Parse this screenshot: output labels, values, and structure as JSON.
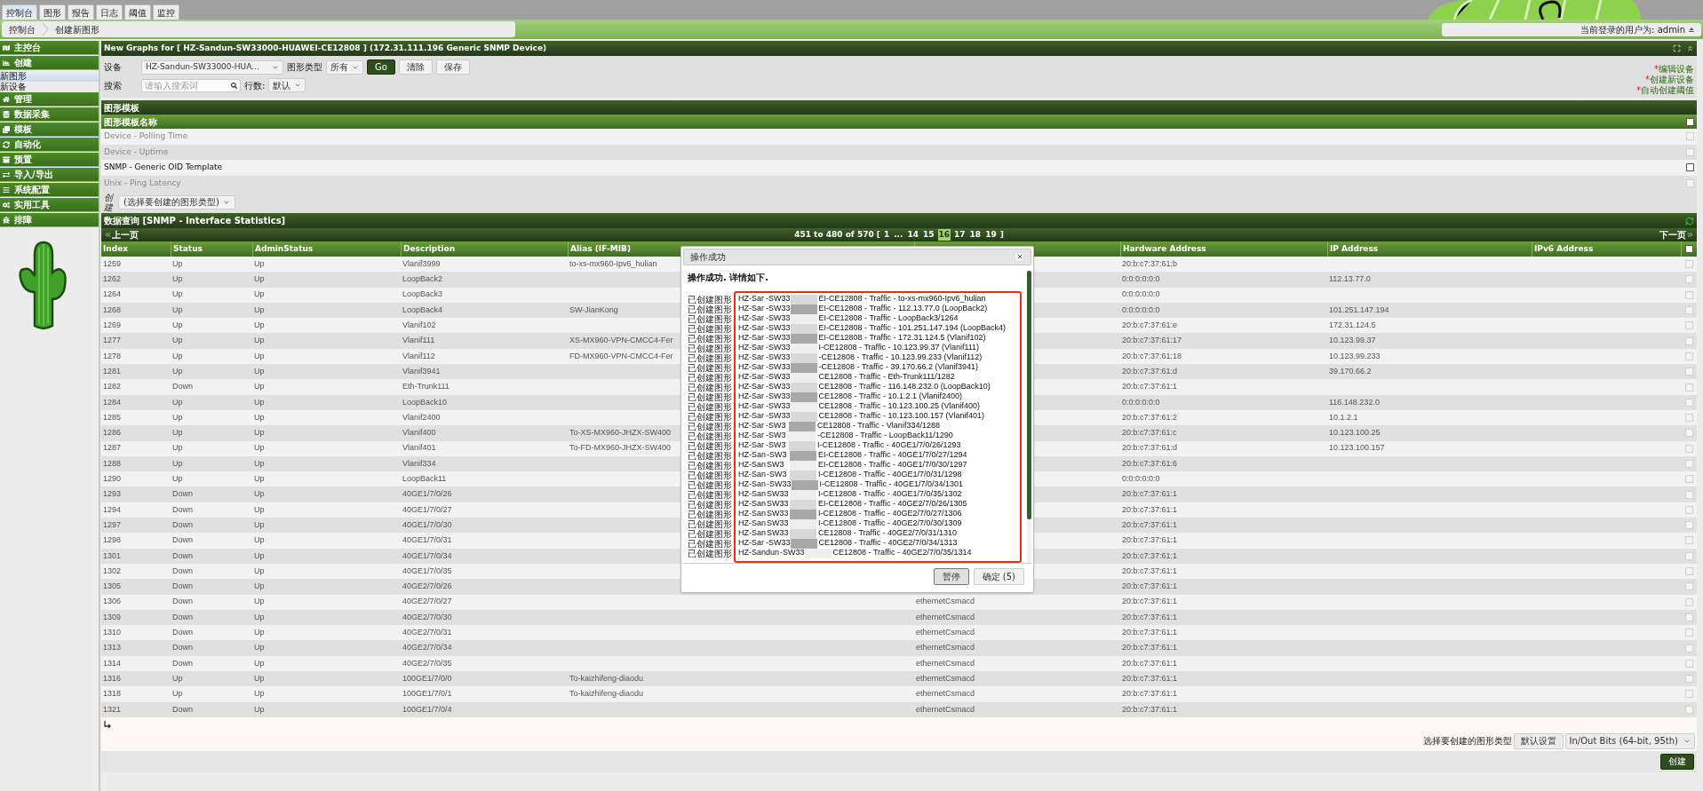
{
  "top_tabs": [
    {
      "label": "控制台",
      "selected": true
    },
    {
      "label": "图形",
      "selected": false
    },
    {
      "label": "报告",
      "selected": false
    },
    {
      "label": "日志",
      "selected": false
    },
    {
      "label": "阈值",
      "selected": false
    },
    {
      "label": "监控",
      "selected": false
    }
  ],
  "breadcrumb": [
    "控制台",
    "创建新图形"
  ],
  "user": {
    "label": "当前登录的用户为: admin"
  },
  "sidebar": [
    {
      "kind": "section",
      "label": "主控台"
    },
    {
      "kind": "section",
      "label": "创建"
    },
    {
      "kind": "link",
      "label": "新图形",
      "selected": true
    },
    {
      "kind": "link",
      "label": "新设备",
      "selected": false
    },
    {
      "kind": "section",
      "label": "管理"
    },
    {
      "kind": "section",
      "label": "数据采集"
    },
    {
      "kind": "section",
      "label": "模板"
    },
    {
      "kind": "section",
      "label": "自动化"
    },
    {
      "kind": "section",
      "label": "预置"
    },
    {
      "kind": "section",
      "label": "导入/导出"
    },
    {
      "kind": "section",
      "label": "系统配置"
    },
    {
      "kind": "section",
      "label": "实用工具"
    },
    {
      "kind": "section",
      "label": "排障"
    }
  ],
  "panel_title": "New Graphs for [ HZ-Sandun-SW33000-HUAWEI-CE12808 ] (172.31.111.196 Generic SNMP Device)",
  "form": {
    "device_label": "设备",
    "device_value": "HZ-Sandun-SW33000-HUA...",
    "type_label": "图形类型",
    "type_value": "所有",
    "buttons": [
      "Go",
      "清除",
      "保存"
    ],
    "search_label": "搜索",
    "search_placeholder": "请输入搜索词",
    "rows_label": "行数:",
    "rows_value": "默认",
    "links": [
      {
        "marker": "*",
        "label": "编辑设备"
      },
      {
        "marker": "*",
        "label": "创建新设备"
      },
      {
        "marker": "*",
        "label": "自动创建阈值"
      }
    ]
  },
  "templates": {
    "title": "图形模板",
    "column": "图形模板名称",
    "select_all_checked": false,
    "rows": [
      {
        "name": "Device - Polling Time",
        "disabled": true,
        "checked": false
      },
      {
        "name": "Device - Uptime",
        "disabled": true,
        "checked": false
      },
      {
        "name": "SNMP - Generic OID Template",
        "disabled": false,
        "checked": false
      },
      {
        "name": "Unix - Ping Latency",
        "disabled": true,
        "checked": false
      }
    ],
    "create_label": "创建",
    "create_select": "(选择要创建的图形类型)"
  },
  "query": {
    "title": "数据查询 [SNMP - Interface Statistics]",
    "prev": "上一页",
    "next": "下一页",
    "range": "451 to 480 of 570 [",
    "pages": [
      {
        "label": "1",
        "selected": false
      },
      {
        "label": "...",
        "selected": false
      },
      {
        "label": "14",
        "selected": false
      },
      {
        "label": "15",
        "selected": false
      },
      {
        "label": "16",
        "selected": true
      },
      {
        "label": "17",
        "selected": false
      },
      {
        "label": "18",
        "selected": false
      },
      {
        "label": "19",
        "selected": false
      }
    ],
    "range_end": "]",
    "columns": [
      "Index",
      "Status",
      "AdminStatus",
      "Description",
      "Alias (IF-MIB)",
      "Hardware Address",
      "IP Address",
      "IPv6 Address"
    ],
    "select_all_checked": false,
    "rows": [
      {
        "index": "1259",
        "status": "Up",
        "admin_status": "Up",
        "description": "Vlanif3999",
        "alias": "to-xs-mx960-Ipv6_hulian",
        "hardware_address": "20:b:c7:37:61:b",
        "checked": false
      },
      {
        "index": "1262",
        "status": "Up",
        "admin_status": "Up",
        "description": "LoopBack2",
        "hardware_address": "0:0:0:0:0:0",
        "ip_address": "112.13.77.0",
        "checked": false
      },
      {
        "index": "1264",
        "status": "Up",
        "admin_status": "Up",
        "description": "LoopBack3",
        "hardware_address": "0:0:0:0:0:0",
        "checked": false
      },
      {
        "index": "1268",
        "status": "Up",
        "admin_status": "Up",
        "description": "LoopBack4",
        "alias": "SW-JianKong",
        "hardware_address": "0:0:0:0:0:0",
        "ip_address": "101.251.147.194",
        "checked": false
      },
      {
        "index": "1269",
        "status": "Up",
        "admin_status": "Up",
        "description": "Vlanif102",
        "hardware_address": "20:b:c7:37:61:e",
        "ip_address": "172.31.124.5",
        "checked": false
      },
      {
        "index": "1277",
        "status": "Up",
        "admin_status": "Up",
        "description": "Vlanif111",
        "alias": "XS-MX960-VPN-CMCC4-Fer",
        "hardware_address": "20:b:c7:37:61:17",
        "ip_address": "10.123.99.37",
        "checked": false
      },
      {
        "index": "1278",
        "status": "Up",
        "admin_status": "Up",
        "description": "Vlanif112",
        "alias": "FD-MX960-VPN-CMCC4-Fer",
        "hardware_address": "20:b:c7:37:61:18",
        "ip_address": "10.123.99.233",
        "checked": false
      },
      {
        "index": "1281",
        "status": "Up",
        "admin_status": "Up",
        "description": "Vlanif3941",
        "hardware_address": "20:b:c7:37:61:d",
        "ip_address": "39.170.66.2",
        "checked": false
      },
      {
        "index": "1282",
        "status": "Down",
        "admin_status": "Up",
        "description": "Eth-Trunk111",
        "hardware_address": "20:b:c7:37:61:1",
        "checked": false
      },
      {
        "index": "1284",
        "status": "Up",
        "admin_status": "Up",
        "description": "LoopBack10",
        "hardware_address": "0:0:0:0:0:0",
        "ip_address": "116.148.232.0",
        "checked": false
      },
      {
        "index": "1285",
        "status": "Up",
        "admin_status": "Up",
        "description": "Vlanif2400",
        "hardware_address": "20:b:c7:37:61:2",
        "ip_address": "10.1.2.1",
        "checked": false
      },
      {
        "index": "1286",
        "status": "Up",
        "admin_status": "Up",
        "description": "Vlanif400",
        "alias": "To-XS-MX960-JHZX-SW400",
        "hardware_address": "20:b:c7:37:61:c",
        "ip_address": "10.123.100.25",
        "checked": false
      },
      {
        "index": "1287",
        "status": "Up",
        "admin_status": "Up",
        "description": "Vlanif401",
        "alias": "To-FD-MX960-JHZX-SW400",
        "hardware_address": "20:b:c7:37:61:d",
        "ip_address": "10.123.100.157",
        "checked": false
      },
      {
        "index": "1288",
        "status": "Up",
        "admin_status": "Up",
        "description": "Vlanif334",
        "hardware_address": "20:b:c7:37:61:6",
        "checked": false
      },
      {
        "index": "1290",
        "status": "Up",
        "admin_status": "Up",
        "description": "LoopBack11",
        "hardware_address": "0:0:0:0:0:0",
        "checked": false
      },
      {
        "index": "1293",
        "status": "Down",
        "admin_status": "Up",
        "description": "40GE1/7/0/26",
        "hardware_address": "20:b:c7:37:61:1",
        "checked": false
      },
      {
        "index": "1294",
        "status": "Down",
        "admin_status": "Up",
        "description": "40GE1/7/0/27",
        "hardware_address": "20:b:c7:37:61:1",
        "checked": false
      },
      {
        "index": "1297",
        "status": "Down",
        "admin_status": "Up",
        "description": "40GE1/7/0/30",
        "hardware_address": "20:b:c7:37:61:1",
        "checked": false
      },
      {
        "index": "1298",
        "status": "Down",
        "admin_status": "Up",
        "description": "40GE1/7/0/31",
        "hardware_address": "20:b:c7:37:61:1",
        "checked": false
      },
      {
        "index": "1301",
        "status": "Down",
        "admin_status": "Up",
        "description": "40GE1/7/0/34",
        "hardware_address": "20:b:c7:37:61:1",
        "checked": false
      },
      {
        "index": "1302",
        "status": "Down",
        "admin_status": "Up",
        "description": "40GE1/7/0/35",
        "hardware_address": "20:b:c7:37:61:1",
        "checked": false
      },
      {
        "index": "1305",
        "status": "Down",
        "admin_status": "Up",
        "description": "40GE2/7/0/26",
        "hardware_address": "20:b:c7:37:61:1",
        "checked": false
      },
      {
        "index": "1306",
        "status": "Down",
        "admin_status": "Up",
        "description": "40GE2/7/0/27",
        "column_6": "ethernetCsmacd",
        "hardware_address": "20:b:c7:37:61:1",
        "checked": false
      },
      {
        "index": "1309",
        "status": "Down",
        "admin_status": "Up",
        "description": "40GE2/7/0/30",
        "column_6": "ethernetCsmacd",
        "hardware_address": "20:b:c7:37:61:1",
        "checked": false
      },
      {
        "index": "1310",
        "status": "Down",
        "admin_status": "Up",
        "description": "40GE2/7/0/31",
        "column_6": "ethernetCsmacd",
        "hardware_address": "20:b:c7:37:61:1",
        "checked": false
      },
      {
        "index": "1313",
        "status": "Down",
        "admin_status": "Up",
        "description": "40GE2/7/0/34",
        "column_6": "ethernetCsmacd",
        "hardware_address": "20:b:c7:37:61:1",
        "checked": false
      },
      {
        "index": "1314",
        "status": "Down",
        "admin_status": "Up",
        "description": "40GE2/7/0/35",
        "column_6": "ethernetCsmacd",
        "hardware_address": "20:b:c7:37:61:1",
        "checked": false
      },
      {
        "index": "1316",
        "status": "Up",
        "admin_status": "Up",
        "description": "100GE1/7/0/0",
        "alias": "To-kaizhifeng-diaodu",
        "column_6": "ethernetCsmacd",
        "hardware_address": "20:b:c7:37:61:1",
        "checked": false
      },
      {
        "index": "1318",
        "status": "Up",
        "admin_status": "Up",
        "description": "100GE1/7/0/1",
        "alias": "To-kaizhifeng-diaodu",
        "column_6": "ethernetCsmacd",
        "hardware_address": "20:b:c7:37:61:1",
        "checked": false
      },
      {
        "index": "1321",
        "status": "Down",
        "admin_status": "Up",
        "description": "100GE1/7/0/4",
        "column_6": "ethernetCsmacd",
        "hardware_address": "20:b:c7:37:61:1",
        "checked": false
      }
    ]
  },
  "footer": {
    "label": "选择要创建的图形类型",
    "default_button": "默认设置",
    "type_select": "In/Out Bits (64-bit, 95th)",
    "create_button": "创建"
  },
  "dialog": {
    "title": "操作成功",
    "message": "操作成功. 详情如下.",
    "buttons": [
      {
        "label": "暂停",
        "focused": true
      },
      {
        "label": "确定 (5)",
        "focused": false
      }
    ],
    "lines": [
      {
        "prefix": "已创建图形",
        "head": "HZ-Sar",
        "middle": "-SW33",
        "tail": "EI-CE12808 - Traffic - to-xs-mx960-Ipv6_hulian"
      },
      {
        "prefix": "已创建图形",
        "head": "HZ-Sar",
        "middle": "-SW33",
        "tail": "EI-CE12808 - Traffic - 112.13.77.0 (LoopBack2)"
      },
      {
        "prefix": "已创建图形",
        "head": "HZ-Sar",
        "middle": "-SW33",
        "tail": "EI-CE12808 - Traffic - LoopBack3/1264"
      },
      {
        "prefix": "已创建图形",
        "head": "HZ-Sar",
        "middle": "-SW33",
        "tail": "EI-CE12808 - Traffic - 101.251.147.194 (LoopBack4)"
      },
      {
        "prefix": "已创建图形",
        "head": "HZ-Sar",
        "middle": "-SW33",
        "tail": "EI-CE12808 - Traffic - 172.31.124.5 (Vlanif102)"
      },
      {
        "prefix": "已创建图形",
        "head": "HZ-Sar",
        "middle": "-SW33",
        "tail": "I-CE12808 - Traffic - 10.123.99.37 (Vlanif111)"
      },
      {
        "prefix": "已创建图形",
        "head": "HZ-Sar",
        "middle": "-SW33",
        "tail": "-CE12808 - Traffic - 10.123.99.233 (Vlanif112)"
      },
      {
        "prefix": "已创建图形",
        "head": "HZ-Sar",
        "middle": "-SW33",
        "tail": "-CE12808 - Traffic - 39.170.66.2 (Vlanif3941)"
      },
      {
        "prefix": "已创建图形",
        "head": "HZ-Sar",
        "middle": "-SW33",
        "tail": "CE12808 - Traffic - Eth-Trunk111/1282"
      },
      {
        "prefix": "已创建图形",
        "head": "HZ-Sar",
        "middle": "-SW33",
        "tail": "CE12808 - Traffic - 116.148.232.0 (LoopBack10)"
      },
      {
        "prefix": "已创建图形",
        "head": "HZ-Sar",
        "middle": "-SW33",
        "tail": "CE12808 - Traffic - 10.1.2.1 (Vlanif2400)"
      },
      {
        "prefix": "已创建图形",
        "head": "HZ-Sar",
        "middle": "-SW33",
        "tail": "CE12808 - Traffic - 10.123.100.25 (Vlanif400)"
      },
      {
        "prefix": "已创建图形",
        "head": "HZ-Sar",
        "middle": "-SW33",
        "tail": "CE12808 - Traffic - 10.123.100.157 (Vlanif401)"
      },
      {
        "prefix": "已创建图形",
        "head": "HZ-Sar",
        "middle": "-SW3",
        "tail": "CE12808 - Traffic - Vlanif334/1288"
      },
      {
        "prefix": "已创建图形",
        "head": "HZ-Sar",
        "middle": "-SW3",
        "tail": "-CE12808 - Traffic - LoopBack11/1290"
      },
      {
        "prefix": "已创建图形",
        "head": "HZ-Sar",
        "middle": "-SW3",
        "tail": "I-CE12808 - Traffic - 40GE1/7/0/26/1293"
      },
      {
        "prefix": "已创建图形",
        "head": "HZ-San",
        "middle": "-SW3",
        "tail": "EI-CE12808 - Traffic - 40GE1/7/0/27/1294"
      },
      {
        "prefix": "已创建图形",
        "head": "HZ-San",
        "middle": "SW3",
        "tail": "EI-CE12808 - Traffic - 40GE1/7/0/30/1297"
      },
      {
        "prefix": "已创建图形",
        "head": "HZ-San",
        "middle": "-SW3",
        "tail": "I-CE12808 - Traffic - 40GE1/7/0/31/1298"
      },
      {
        "prefix": "已创建图形",
        "head": "HZ-San",
        "middle": "-SW33",
        "tail": "I-CE12808 - Traffic - 40GE1/7/0/34/1301"
      },
      {
        "prefix": "已创建图形",
        "head": "HZ-San",
        "middle": "SW33",
        "tail": "I-CE12808 - Traffic - 40GE1/7/0/35/1302"
      },
      {
        "prefix": "已创建图形",
        "head": "HZ-San",
        "middle": "SW33",
        "tail": "EI-CE12808 - Traffic - 40GE2/7/0/26/1305"
      },
      {
        "prefix": "已创建图形",
        "head": "HZ-San",
        "middle": "SW33",
        "tail": "I-CE12808 - Traffic - 40GE2/7/0/27/1306"
      },
      {
        "prefix": "已创建图形",
        "head": "HZ-San",
        "middle": "SW33",
        "tail": "I-CE12808 - Traffic - 40GE2/7/0/30/1309"
      },
      {
        "prefix": "已创建图形",
        "head": "HZ-San",
        "middle": "SW33",
        "tail": "CE12808 - Traffic - 40GE2/7/0/31/1310"
      },
      {
        "prefix": "已创建图形",
        "head": "HZ-Sar",
        "middle": "-SW33",
        "tail": "CE12808 - Traffic - 40GE2/7/0/34/1313"
      },
      {
        "prefix": "已创建图形",
        "head": "HZ-Sandun",
        "middle": "-SW33",
        "tail": "CE12808 - Traffic - 40GE2/7/0/35/1314"
      }
    ]
  }
}
